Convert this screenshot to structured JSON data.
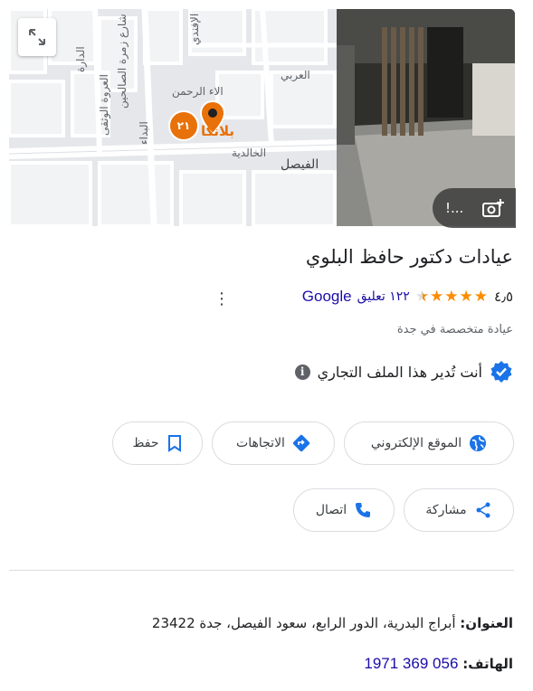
{
  "map": {
    "labels": {
      "streets": [
        "العربي",
        "الفيصل",
        "الخالدية",
        "الإفندي",
        "شارع زمرة الصالحين",
        "العروة الوثقى",
        "الدارة",
        "البداء",
        "الاء الرحمن"
      ],
      "pin_place": "بلانكا",
      "marker_badge": "٢١"
    },
    "expand_icon": "fullscreen-expand-icon"
  },
  "photo": {
    "button_text": "!...",
    "button_icon": "add-photo-icon"
  },
  "business": {
    "name": "عيادات دكتور حافظ البلوي",
    "rating": "٤٫٥",
    "stars_filled": 4.5,
    "reviews": "١٢٢ تعليق",
    "reviews_source": "Google",
    "category": "عيادة متخصصة في جدة",
    "manage_text": "أنت تُدير هذا الملف التجاري",
    "verified_icon": "verified-badge-icon",
    "info_icon": "info-icon"
  },
  "actions": {
    "website": "الموقع الإلكتروني",
    "directions": "الاتجاهات",
    "save": "حفظ",
    "share": "مشاركة",
    "call": "اتصال"
  },
  "details": {
    "address_label": "العنوان:",
    "address_value": "أبراج البدرية، الدور الرابع، سعود الفيصل، جدة 23422",
    "phone_label": "الهاتف:",
    "phone_value": "056 369 1971"
  },
  "colors": {
    "accent_blue": "#1a73e8",
    "link_blue": "#1a0dab",
    "star_orange": "#fb8c00",
    "marker_orange": "#e8710a"
  }
}
